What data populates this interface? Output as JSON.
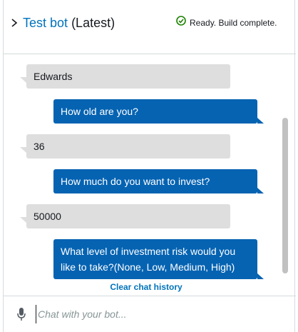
{
  "header": {
    "bot_name": "Test bot",
    "version": "(Latest)",
    "status": "Ready. Build complete."
  },
  "messages": [
    {
      "role": "user",
      "text": "Edwards"
    },
    {
      "role": "bot",
      "text": "How old are you?"
    },
    {
      "role": "user",
      "text": "36"
    },
    {
      "role": "bot",
      "text": "How much do you want to invest?"
    },
    {
      "role": "user",
      "text": "50000"
    },
    {
      "role": "bot",
      "text": "What level of investment risk would you like to take?(None, Low, Medium, High)"
    }
  ],
  "clear_history_label": "Clear chat history",
  "input": {
    "placeholder": "Chat with your bot...",
    "value": ""
  },
  "icons": {
    "expand": "chevron-right-icon",
    "status": "check-circle-icon",
    "mic": "microphone-icon"
  },
  "colors": {
    "accent": "#0073bb",
    "bot_bubble": "#0563b2",
    "user_bubble": "#dedede",
    "success": "#1d8102"
  }
}
